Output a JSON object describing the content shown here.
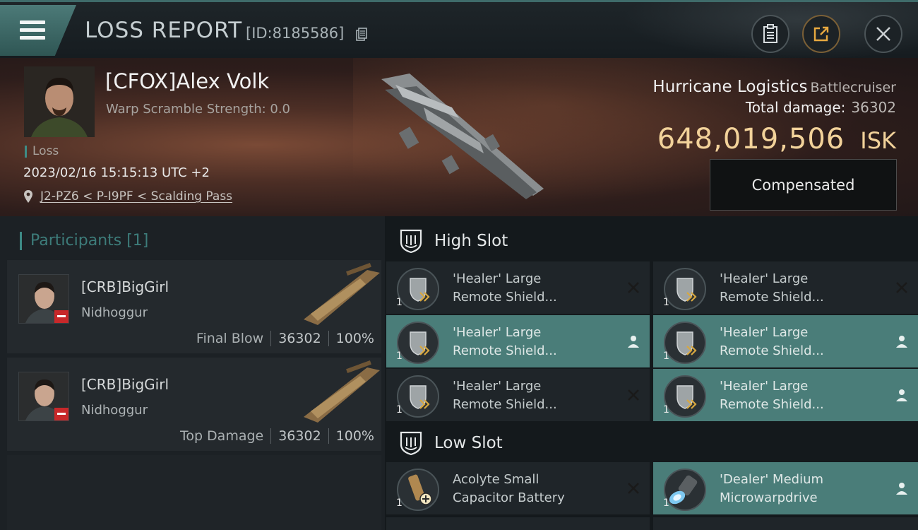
{
  "header": {
    "title": "LOSS REPORT",
    "report_id": "[ID:8185586]"
  },
  "victim": {
    "name": "[CFOX]Alex Volk",
    "warp_scramble": "Warp Scramble Strength: 0.0",
    "status": "Loss",
    "datetime": "2023/02/16 15:15:13 UTC +2",
    "location": "J2-PZ6 < P-I9PF < Scalding Pass",
    "ship_name": "Hurricane Logistics",
    "ship_class": "Battlecruiser",
    "total_damage_label": "Total damage:",
    "total_damage": "36302",
    "isk_value": "648,019,506",
    "isk_unit": "ISK",
    "compensated_label": "Compensated"
  },
  "participants": {
    "title": "Participants [1]",
    "items": [
      {
        "name": "[CRB]BigGirl",
        "ship": "Nidhoggur",
        "role": "Final Blow",
        "damage": "36302",
        "percent": "100%"
      },
      {
        "name": "[CRB]BigGirl",
        "ship": "Nidhoggur",
        "role": "Top Damage",
        "damage": "36302",
        "percent": "100%"
      }
    ]
  },
  "slots": {
    "high": {
      "label": "High Slot",
      "items": [
        {
          "line1": "'Healer' Large",
          "line2": "Remote Shield...",
          "qty": "1",
          "status": "destroyed"
        },
        {
          "line1": "'Healer' Large",
          "line2": "Remote Shield...",
          "qty": "1",
          "status": "destroyed"
        },
        {
          "line1": "'Healer' Large",
          "line2": "Remote Shield...",
          "qty": "1",
          "status": "dropped"
        },
        {
          "line1": "'Healer' Large",
          "line2": "Remote Shield...",
          "qty": "1",
          "status": "dropped"
        },
        {
          "line1": "'Healer' Large",
          "line2": "Remote Shield...",
          "qty": "1",
          "status": "destroyed"
        },
        {
          "line1": "'Healer' Large",
          "line2": "Remote Shield...",
          "qty": "1",
          "status": "dropped"
        }
      ]
    },
    "low": {
      "label": "Low Slot",
      "items": [
        {
          "line1": "Acolyte Small",
          "line2": "Capacitor Battery",
          "qty": "1",
          "status": "destroyed"
        },
        {
          "line1": "'Dealer' Medium",
          "line2": "Microwarpdrive",
          "qty": "1",
          "status": "dropped"
        }
      ]
    }
  },
  "colors": {
    "accent_teal": "#4a7d79",
    "isk_gold": "#f2d29a",
    "status_red": "#c8282a"
  }
}
